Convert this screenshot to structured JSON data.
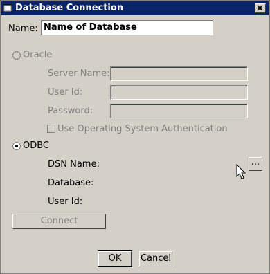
{
  "window": {
    "title": "Database Connection"
  },
  "name_field": {
    "label": "Name:",
    "value": "Name of Database"
  },
  "oracle": {
    "label": "Oracle",
    "selected": false,
    "enabled": false,
    "server_name_label": "Server Name:",
    "user_id_label": "User Id:",
    "password_label": "Password:",
    "os_auth_label": "Use Operating System Authentication"
  },
  "odbc": {
    "label": "ODBC",
    "selected": true,
    "dsn_name_label": "DSN Name:",
    "browse_label": "...",
    "database_label": "Database:",
    "user_id_label": "User Id:"
  },
  "buttons": {
    "connect": "Connect",
    "ok": "OK",
    "cancel": "Cancel"
  }
}
